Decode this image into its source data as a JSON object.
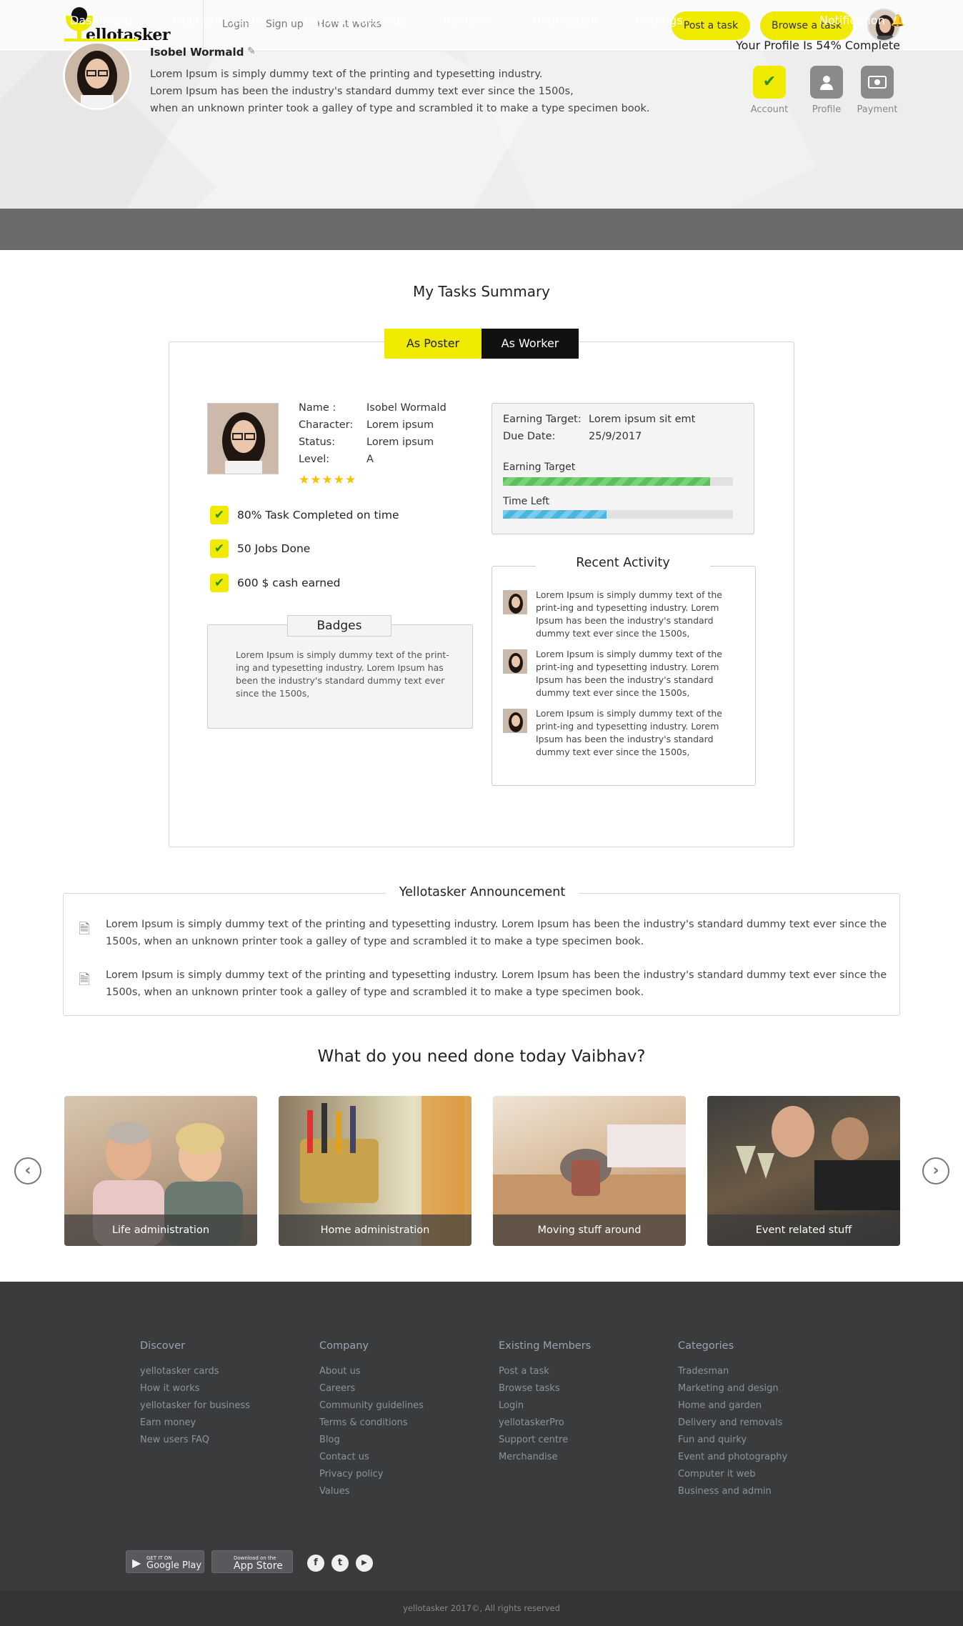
{
  "header": {
    "logo_text": "ellotasker",
    "nav": [
      "Login",
      "Sign up",
      "How it works"
    ],
    "post_task": "Post a task",
    "browse_task": "Browse a task"
  },
  "profile": {
    "name": "Isobel Wormald",
    "desc_lines": [
      "Lorem Ipsum is simply dummy text of the printing and typesetting industry.",
      "Lorem Ipsum has been the industry's standard dummy text ever since the 1500s,",
      "when an unknown printer took a galley of type and scrambled it to make a type specimen book."
    ],
    "completion": "Your Profile Is 54% Complete",
    "steps": [
      {
        "label": "Account",
        "icon": "check-icon"
      },
      {
        "label": "Profile",
        "icon": "user-icon"
      },
      {
        "label": "Payment",
        "icon": "money-icon"
      }
    ]
  },
  "tabs": [
    "Dashboard",
    "Payment History",
    "Payment Methods",
    "Reviews",
    "Notification",
    "Settings"
  ],
  "tab_notification": "Notification",
  "summary": {
    "title": "My Tasks Summary",
    "toggle_poster": "As Poster",
    "toggle_worker": "As Worker",
    "labels": [
      "Name :",
      "Character:",
      "Status:",
      "Level:"
    ],
    "values": [
      "Isobel Wormald",
      "Lorem ipsum",
      "Lorem ipsum",
      "A"
    ],
    "rating": 5,
    "checks": [
      "80% Task Completed on time",
      "50 Jobs Done",
      "600 $ cash earned"
    ],
    "badges_title": "Badges",
    "badges_text": "Lorem Ipsum is simply dummy text of the print-ing and typesetting industry.  Lorem Ipsum has been the industry's standard dummy text ever since the 1500s,",
    "earning_target_label": "Earning Target:",
    "earning_target_value": "Lorem ipsum sit emt",
    "due_date_label": "Due Date:",
    "due_date_value": "25/9/2017",
    "bar_earning_label": "Earning Target",
    "bar_earning_progress": 0.9,
    "bar_time_label": "Time Left",
    "bar_time_progress": 0.45,
    "recent_title": "Recent Activity",
    "recent_items": [
      "Lorem Ipsum is simply dummy text of the print-ing and typesetting industry.  Lorem Ipsum has been the industry's standard dummy text ever since the 1500s,",
      "Lorem Ipsum is simply dummy text of the print-ing and typesetting industry.  Lorem Ipsum has been the industry's standard dummy text ever since the 1500s,",
      "Lorem Ipsum is simply dummy text of the print-ing and typesetting industry.  Lorem Ipsum has been the industry's standard dummy text ever since the 1500s,"
    ]
  },
  "announcement": {
    "title": "Yellotasker Announcement",
    "items": [
      "Lorem Ipsum is simply dummy text of the printing and typesetting industry.  Lorem Ipsum has been the industry's standard dummy text ever since the 1500s, when an unknown printer took a galley of type and scrambled it to make a type specimen book.",
      "Lorem Ipsum is simply dummy text of the printing and typesetting industry.  Lorem Ipsum has been the industry's standard dummy text ever since the 1500s, when an unknown printer took a galley of type and scrambled it to make a type specimen book."
    ]
  },
  "need": {
    "title": "What do you need done today Vaibhav?",
    "cards": [
      "Life administration",
      "Home administration",
      "Moving stuff around",
      "Event related stuff"
    ]
  },
  "footer": {
    "cols": [
      {
        "title": "Discover",
        "links": [
          "yellotasker cards",
          "How it works",
          "yellotasker for business",
          "Earn money",
          "New users FAQ"
        ]
      },
      {
        "title": "Company",
        "links": [
          "About us",
          "Careers",
          "Community guidelines",
          "Terms & conditions",
          "Blog",
          "Contact us",
          "Privacy policy",
          "Values"
        ]
      },
      {
        "title": "Existing Members",
        "links": [
          "Post a task",
          "Browse tasks",
          "Login",
          "yellotaskerPro",
          "Support centre",
          "Merchandise"
        ]
      },
      {
        "title": "Categories",
        "links": [
          "Tradesman",
          "Marketing and design",
          "Home and garden",
          "Delivery and removals",
          "Fun and quirky",
          "Event and photography",
          "Computer it web",
          "Business and admin"
        ]
      }
    ],
    "google_small": "GET IT ON",
    "google_big": "Google Play",
    "apple_small": "Download on the",
    "apple_big": "App Store",
    "social": [
      "f",
      "t",
      "▶"
    ],
    "copyright": "yellotasker 2017©, All rights reserved"
  },
  "colors": {
    "accent": "#f0e900",
    "tabbar": "#6b6b6b",
    "footer": "#3a3b3d"
  }
}
